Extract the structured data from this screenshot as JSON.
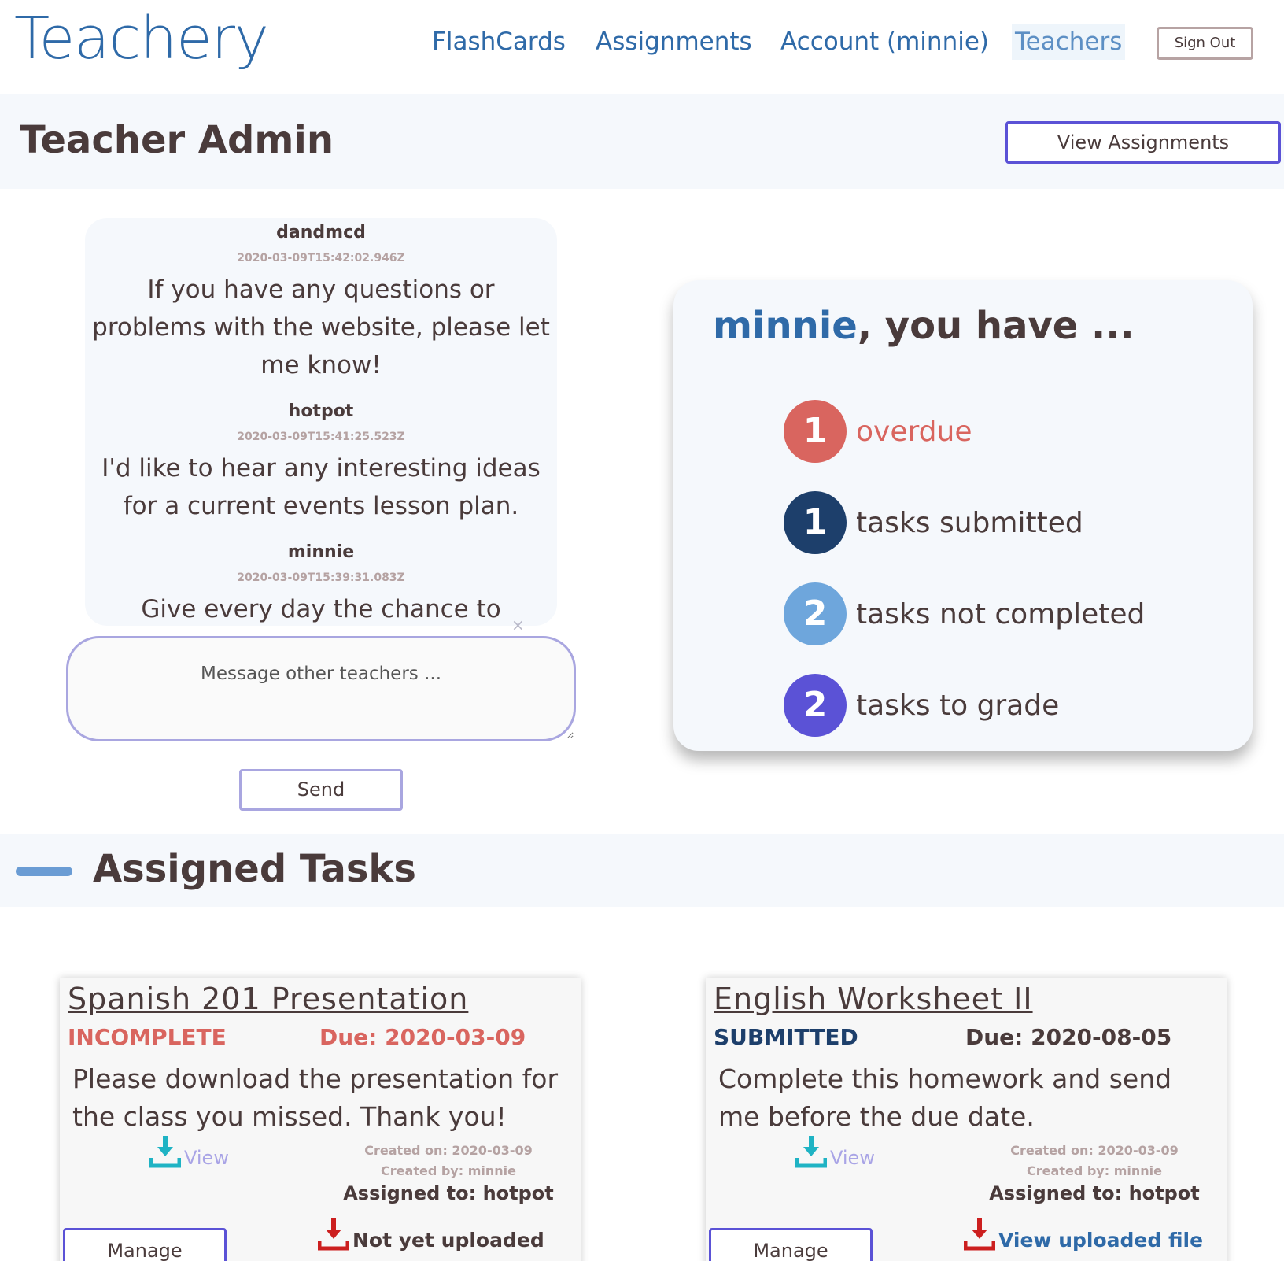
{
  "app": {
    "logo": "Teachery",
    "nav": [
      {
        "label": "FlashCards"
      },
      {
        "label": "Assignments"
      },
      {
        "label": "Account (minnie)"
      },
      {
        "label": "Teachers"
      }
    ],
    "sign_out": "Sign Out",
    "colors": {
      "brand": "#2f6aa8",
      "accent": "#5b52d6",
      "overdue": "#d9655f",
      "submitted": "#1d3f6b",
      "not_completed": "#6ea6dc",
      "to_grade": "#5b52d6"
    }
  },
  "header": {
    "title": "Teacher Admin",
    "view_assignments": "View Assignments"
  },
  "chat": {
    "messages": [
      {
        "author": "dandmcd",
        "time": "2020-03-09T15:42:02.946Z",
        "text": "If you have any questions or problems with the website, please let me know!"
      },
      {
        "author": "hotpot",
        "time": "2020-03-09T15:41:25.523Z",
        "text": "I'd like to hear any interesting ideas for a current events lesson plan."
      },
      {
        "author": "minnie",
        "time": "2020-03-09T15:39:31.083Z",
        "text": "Give every day the chance to become the most beautiful day of your life."
      }
    ],
    "close_icon": "×",
    "input_placeholder": "Message other teachers ...",
    "send": "Send"
  },
  "summary": {
    "user": "minnie",
    "title_rest": ", you have ...",
    "stats": [
      {
        "count": "1",
        "label": "overdue"
      },
      {
        "count": "1",
        "label": "tasks submitted"
      },
      {
        "count": "2",
        "label": "tasks not completed"
      },
      {
        "count": "2",
        "label": "tasks to grade"
      }
    ]
  },
  "tasks": {
    "section_title": "Assigned Tasks",
    "cards": [
      {
        "title": "Spanish 201 Presentation",
        "status": "INCOMPLETE",
        "due": "Due: 2020-03-09",
        "description": "Please download the presentation for the class you missed. Thank you!",
        "view": "View",
        "created_on": "Created on: 2020-03-09",
        "created_by": "Created by: minnie",
        "assigned_to": "Assigned to: hotpot",
        "manage": "Manage",
        "upload": "Not yet uploaded"
      },
      {
        "title": "English Worksheet II",
        "status": "SUBMITTED",
        "due": "Due: 2020-08-05",
        "description": "Complete this homework and send me before the due date.",
        "view": "View",
        "created_on": "Created on: 2020-03-09",
        "created_by": "Created by: minnie",
        "assigned_to": "Assigned to: hotpot",
        "manage": "Manage",
        "upload": "View uploaded file"
      }
    ]
  }
}
